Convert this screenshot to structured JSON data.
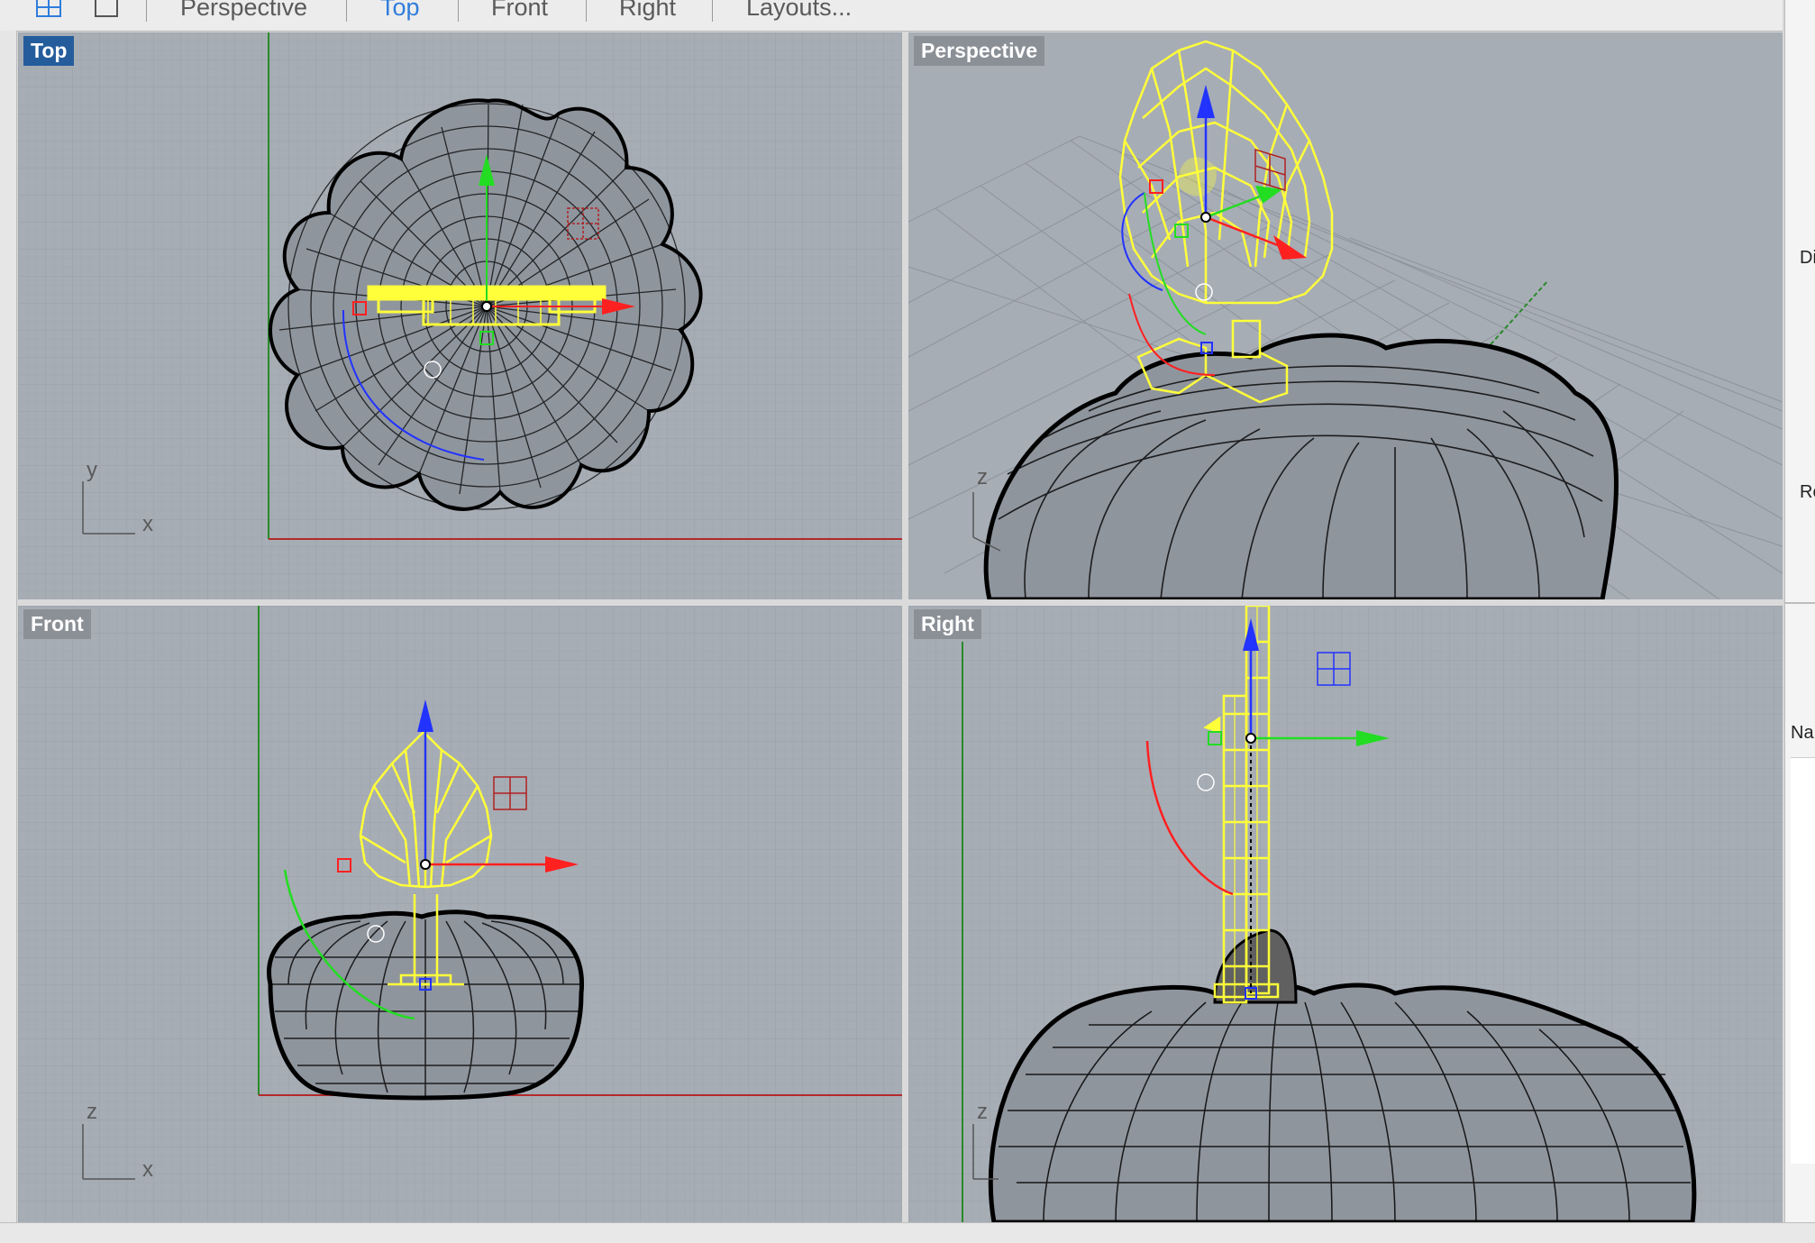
{
  "toolbar": {
    "tabs": [
      {
        "label": "Perspective",
        "active": false
      },
      {
        "label": "Top",
        "active": true
      },
      {
        "label": "Front",
        "active": false
      },
      {
        "label": "Right",
        "active": false
      },
      {
        "label": "Layouts...",
        "active": false
      }
    ],
    "icons": [
      "four-viewports-icon",
      "single-viewport-icon"
    ]
  },
  "viewports": {
    "top": {
      "label": "Top",
      "active": true,
      "axis_a": "x",
      "axis_b": "y"
    },
    "perspective": {
      "label": "Perspective",
      "active": false,
      "axis_b": "z"
    },
    "front": {
      "label": "Front",
      "active": false,
      "axis_a": "x",
      "axis_b": "z"
    },
    "right": {
      "label": "Right",
      "active": false,
      "axis_b": "z"
    }
  },
  "right_panel": {
    "items": [
      "Di",
      "Re",
      "Na"
    ]
  },
  "colors": {
    "viewport_bg": "#a7adb5",
    "active_label": "#255d9c",
    "selection": "#ffff3a",
    "gizmo_x": "#ff2020",
    "gizmo_y": "#22dd22",
    "gizmo_z": "#2233ff",
    "wire": "#000000"
  }
}
